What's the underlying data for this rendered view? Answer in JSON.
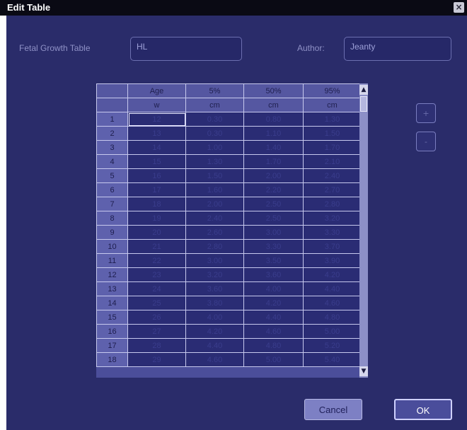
{
  "window": {
    "title": "Edit Table",
    "close_label": "×"
  },
  "form": {
    "table_label": "Fetal Growth Table",
    "table_value": "HL",
    "author_label": "Author:",
    "author_value": "Jeanty"
  },
  "table": {
    "columns": [
      "Age",
      "5%",
      "50%",
      "95%"
    ],
    "units": [
      "w",
      "cm",
      "cm",
      "cm"
    ],
    "rows": [
      [
        "1",
        "12",
        "0.30",
        "0.80",
        "1.30"
      ],
      [
        "2",
        "13",
        "0.30",
        "1.10",
        "1.50"
      ],
      [
        "3",
        "14",
        "1.00",
        "1.40",
        "1.70"
      ],
      [
        "4",
        "15",
        "1.30",
        "1.70",
        "2.10"
      ],
      [
        "5",
        "16",
        "1.50",
        "2.00",
        "2.40"
      ],
      [
        "6",
        "17",
        "1.60",
        "2.20",
        "2.70"
      ],
      [
        "7",
        "18",
        "2.00",
        "2.50",
        "2.80"
      ],
      [
        "8",
        "19",
        "2.40",
        "2.50",
        "3.20"
      ],
      [
        "9",
        "20",
        "2.60",
        "3.00",
        "3.30"
      ],
      [
        "10",
        "21",
        "2.80",
        "3.30",
        "3.70"
      ],
      [
        "11",
        "22",
        "3.00",
        "3.50",
        "3.90"
      ],
      [
        "12",
        "23",
        "3.20",
        "3.60",
        "4.20"
      ],
      [
        "13",
        "24",
        "3.60",
        "4.00",
        "4.40"
      ],
      [
        "14",
        "25",
        "3.80",
        "4.20",
        "4.60"
      ],
      [
        "15",
        "26",
        "4.00",
        "4.40",
        "4.80"
      ],
      [
        "16",
        "27",
        "4.20",
        "4.60",
        "5.00"
      ],
      [
        "17",
        "28",
        "4.40",
        "4.80",
        "5.20"
      ],
      [
        "18",
        "29",
        "4.60",
        "5.00",
        "5.40"
      ]
    ]
  },
  "scrollbar": {
    "up_icon": "▲",
    "down_icon": "▼"
  },
  "side_buttons": {
    "add_label": "+",
    "remove_label": "-"
  },
  "buttons": {
    "cancel_label": "Cancel",
    "ok_label": "OK"
  }
}
